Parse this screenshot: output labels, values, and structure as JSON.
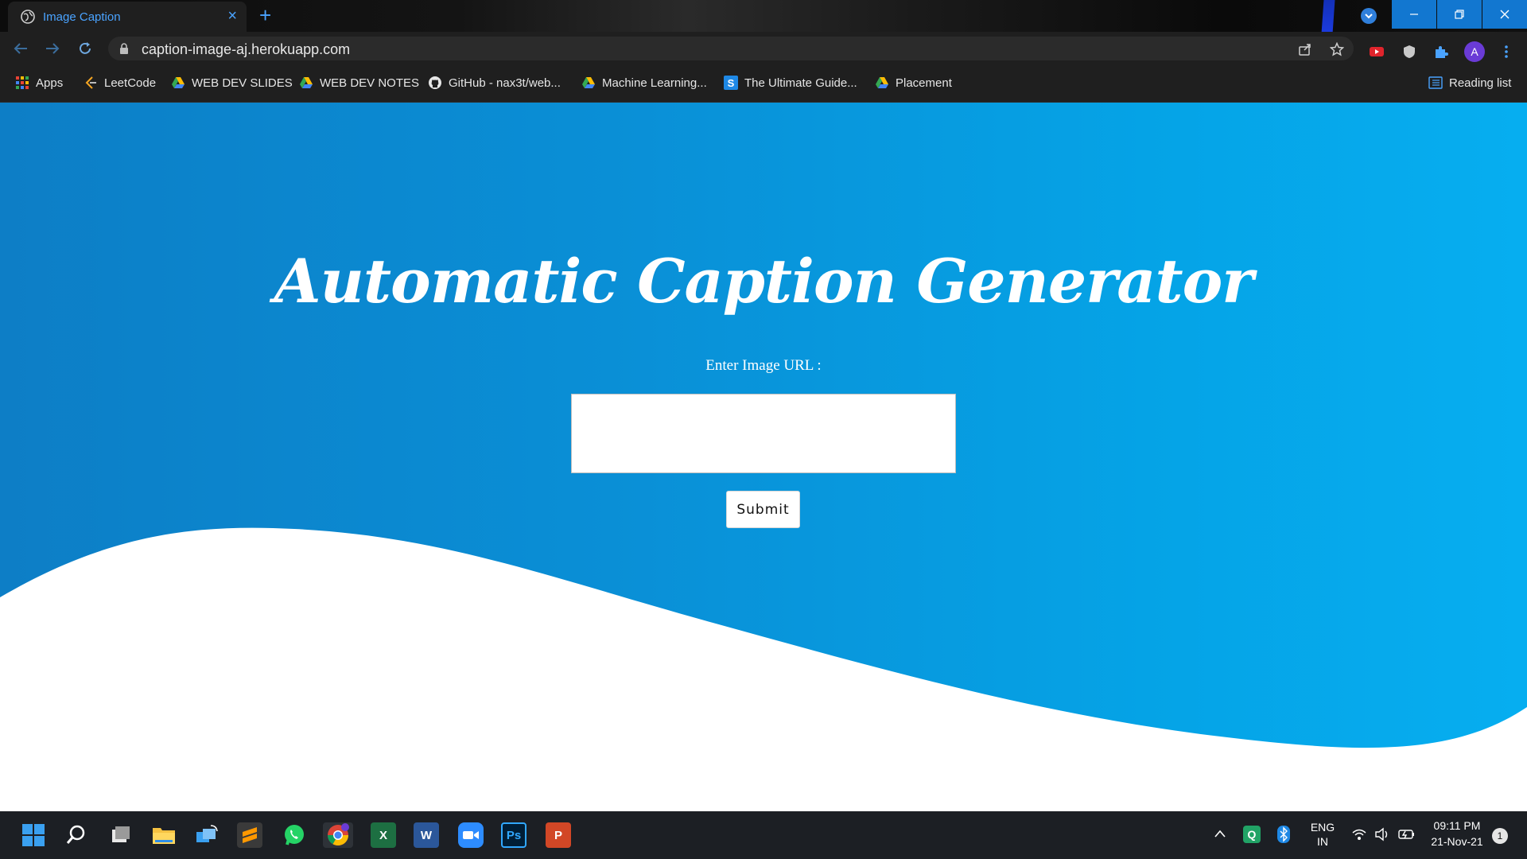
{
  "browser": {
    "tab_title": "Image Caption",
    "tab_close": "×",
    "new_tab": "+",
    "url": "caption-image-aj.herokuapp.com",
    "avatar_letter": "A",
    "bookmarks": [
      {
        "label": "Apps",
        "icon": "apps-grid-icon"
      },
      {
        "label": "LeetCode",
        "icon": "leetcode-icon"
      },
      {
        "label": "WEB DEV SLIDES",
        "icon": "google-drive-icon"
      },
      {
        "label": "WEB DEV NOTES",
        "icon": "google-drive-icon"
      },
      {
        "label": "GitHub - nax3t/web...",
        "icon": "github-icon"
      },
      {
        "label": "Machine Learning...",
        "icon": "google-drive-icon"
      },
      {
        "label": "The Ultimate Guide...",
        "icon": "s-logo-icon"
      },
      {
        "label": "Placement",
        "icon": "google-drive-icon"
      }
    ],
    "reading_list": "Reading list"
  },
  "page": {
    "heading": "Automatic Caption Generator",
    "input_label": "Enter Image URL :",
    "input_value": "",
    "submit_label": "Submit"
  },
  "taskbar": {
    "apps": [
      "windows-start",
      "search",
      "task-view",
      "file-explorer",
      "connect",
      "sublime-text",
      "whatsapp",
      "chrome",
      "excel",
      "word",
      "zoom",
      "photoshop",
      "powerpoint"
    ],
    "language_top": "ENG",
    "language_bottom": "IN",
    "time": "09:11 PM",
    "date": "21-Nov-21",
    "notification_count": "1"
  },
  "colors": {
    "page_gradient_start": "#0d7ec6",
    "page_gradient_end": "#06aef0",
    "tab_accent": "#4aa3ff",
    "window_controls": "#1277d0"
  }
}
